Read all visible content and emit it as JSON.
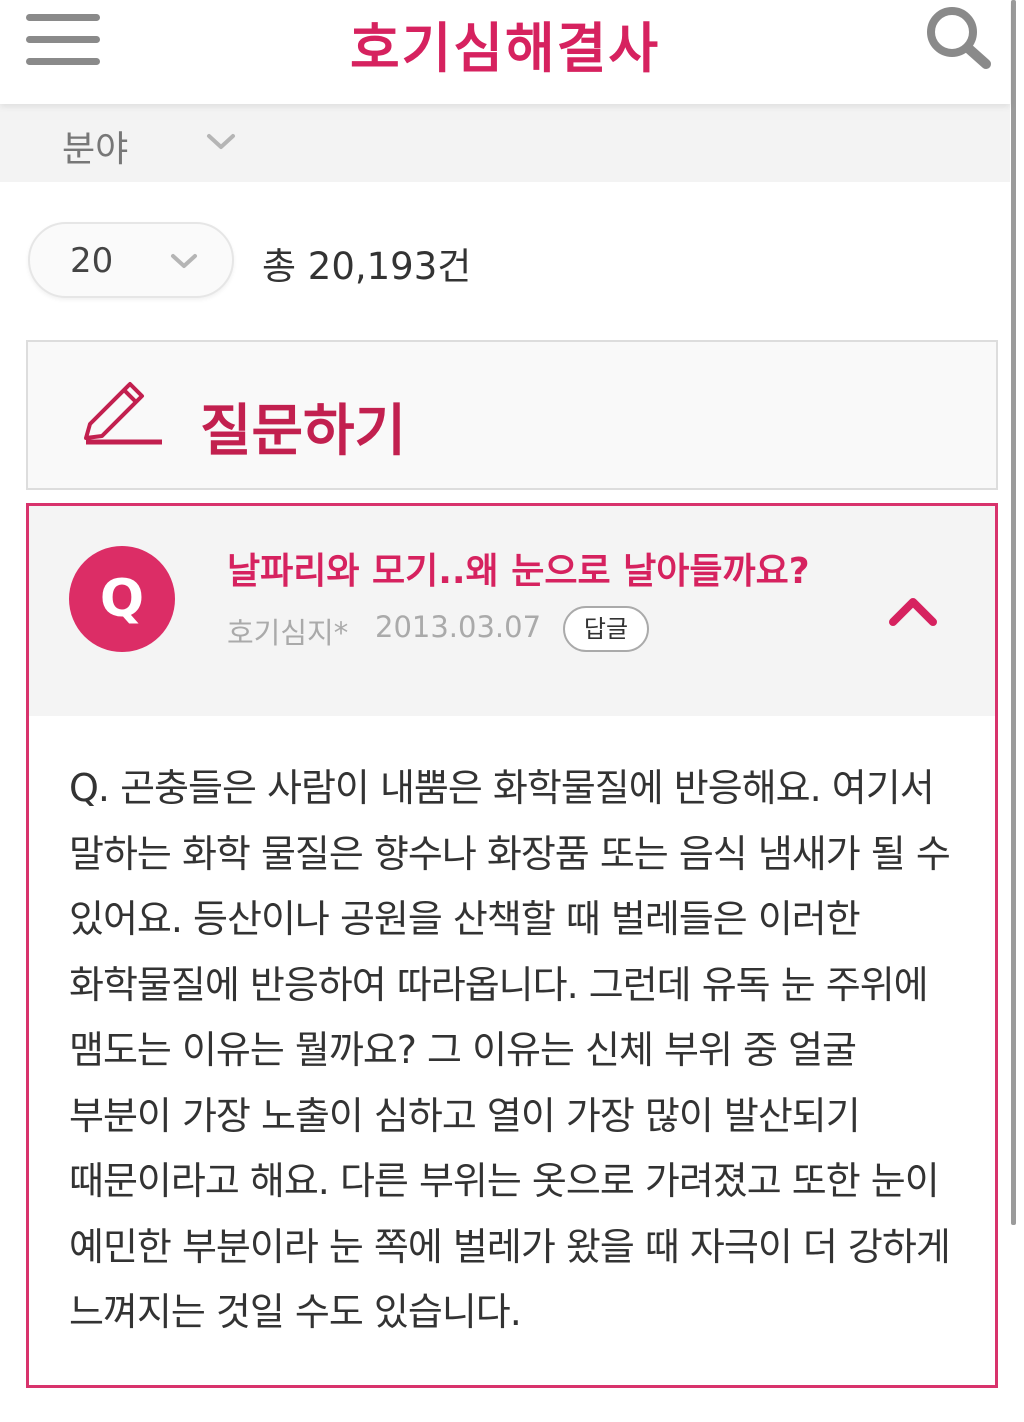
{
  "header": {
    "title": "호기심해결사",
    "menu_icon": "hamburger-menu-icon",
    "search_icon": "search-icon"
  },
  "filter": {
    "category_label": "분야",
    "page_size": "20",
    "total": "총 20,193건"
  },
  "ask": {
    "label": "질문하기",
    "icon": "pencil-icon"
  },
  "question": {
    "badge": "Q",
    "title": "날파리와 모기..왜 눈으로 날아들까요?",
    "author": "호기심지*",
    "date": "2013.03.07",
    "reply_label": "답글",
    "collapse_icon": "chevron-up-icon",
    "body": "Q. 곤충들은 사람이 내뿜은 화학물질에 반응해요. 여기서 말하는 화학 물질은 향수나 화장품 또는 음식 냄새가 될 수 있어요. 등산이나 공원을 산책할 때 벌레들은 이러한 화학물질에 반응하여 따라옵니다. 그런데 유독 눈 주위에 맴도는 이유는 뭘까요? 그 이유는 신체 부위 중 얼굴 부분이 가장 노출이 심하고 열이 가장 많이 발산되기 때문이라고 해요. 다른 부위는 옷으로 가려졌고 또한 눈이 예민한 부분이라 눈 쪽에 벌레가 왔을 때 자극이 더 강하게 느껴지는 것일 수도 있습니다."
  },
  "colors": {
    "accent": "#d6225f",
    "badge": "#dc2d66",
    "card_border": "#d8336c"
  }
}
